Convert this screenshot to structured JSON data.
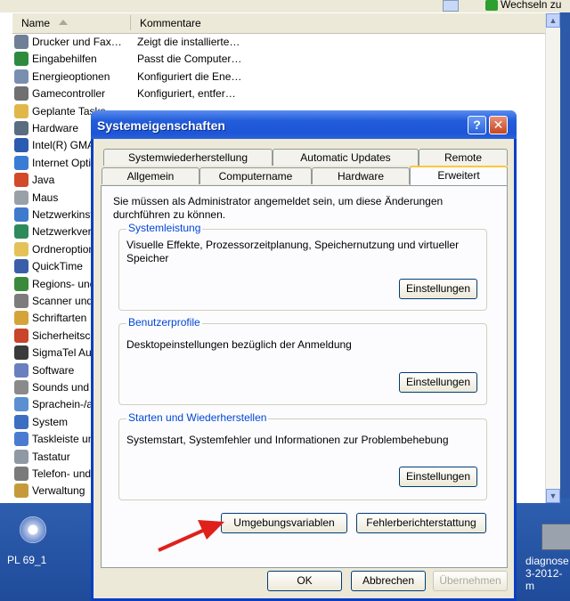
{
  "topbar": {
    "go_label": "Wechseln zu"
  },
  "explorer": {
    "columns": {
      "name": "Name",
      "comment": "Kommentare"
    },
    "rows": [
      {
        "name": "Drucker und Fax…",
        "comment": "Zeigt die installierte…",
        "color": "#6f7f96"
      },
      {
        "name": "Eingabehilfen",
        "comment": "Passt die Computer…",
        "color": "#2e8b3e"
      },
      {
        "name": "Energieoptionen",
        "comment": "Konfiguriert die Ene…",
        "color": "#7a8fb0"
      },
      {
        "name": "Gamecontroller",
        "comment": "Konfiguriert, entfer…",
        "color": "#707070"
      },
      {
        "name": "Geplante Tasks",
        "comment": "",
        "color": "#e0b84a"
      },
      {
        "name": "Hardware",
        "comment": "",
        "color": "#5a6d80"
      },
      {
        "name": "Intel(R) GMA",
        "comment": "",
        "color": "#2a5bb0"
      },
      {
        "name": "Internet Optionen",
        "comment": "",
        "color": "#3a7bd5"
      },
      {
        "name": "Java",
        "comment": "",
        "color": "#d24a2a"
      },
      {
        "name": "Maus",
        "comment": "",
        "color": "#9aa0a8"
      },
      {
        "name": "Netzwerkinstallation",
        "comment": "",
        "color": "#3f7acc"
      },
      {
        "name": "Netzwerkverbindungen",
        "comment": "",
        "color": "#2f8a5a"
      },
      {
        "name": "Ordneroptionen",
        "comment": "",
        "color": "#e5c15a"
      },
      {
        "name": "QuickTime",
        "comment": "",
        "color": "#3a5fa8"
      },
      {
        "name": "Regions- und Sprachoptionen",
        "comment": "",
        "color": "#3b8a3b"
      },
      {
        "name": "Scanner und Kameras",
        "comment": "",
        "color": "#7c7c7c"
      },
      {
        "name": "Schriftarten",
        "comment": "",
        "color": "#d4a43a"
      },
      {
        "name": "Sicherheitscenter",
        "comment": "",
        "color": "#c8442a"
      },
      {
        "name": "SigmaTel Audio",
        "comment": "",
        "color": "#3a3a3a"
      },
      {
        "name": "Software",
        "comment": "",
        "color": "#6a7fbf"
      },
      {
        "name": "Sounds und Audiogeräte",
        "comment": "",
        "color": "#8a8a8a"
      },
      {
        "name": "Sprachein-/ausgabe",
        "comment": "",
        "color": "#5b8fd1"
      },
      {
        "name": "System",
        "comment": "",
        "color": "#3c6ec2"
      },
      {
        "name": "Taskleiste und Startmenü",
        "comment": "",
        "color": "#4a7bd1"
      },
      {
        "name": "Tastatur",
        "comment": "",
        "color": "#9098a4"
      },
      {
        "name": "Telefon- und Modemoptionen",
        "comment": "",
        "color": "#7a7a7a"
      },
      {
        "name": "Verwaltung",
        "comment": "",
        "color": "#c69a3a"
      }
    ]
  },
  "desktop": {
    "icon1_label": "PL 69_1",
    "icon2_label1": "diagnose",
    "icon2_label2": "3-2012-m"
  },
  "dialog": {
    "title": "Systemeigenschaften",
    "help_symbol": "?",
    "close_symbol": "✕",
    "tabs_back": [
      "Systemwiederherstellung",
      "Automatic Updates",
      "Remote"
    ],
    "tabs_front": [
      "Allgemein",
      "Computername",
      "Hardware",
      "Erweitert"
    ],
    "active_tab": "Erweitert",
    "admin_text": "Sie müssen als Administrator angemeldet sein, um diese Änderungen durchführen zu können.",
    "groups": [
      {
        "label": "Systemleistung",
        "text": "Visuelle Effekte, Prozessorzeitplanung, Speichernutzung und virtueller Speicher",
        "button": "Einstellungen"
      },
      {
        "label": "Benutzerprofile",
        "text": "Desktopeinstellungen bezüglich der Anmeldung",
        "button": "Einstellungen"
      },
      {
        "label": "Starten und Wiederherstellen",
        "text": "Systemstart, Systemfehler und Informationen zur Problembehebung",
        "button": "Einstellungen"
      }
    ],
    "env_button": "Umgebungsvariablen",
    "error_button": "Fehlerberichterstattung",
    "ok": "OK",
    "cancel": "Abbrechen",
    "apply": "Übernehmen"
  },
  "colors": {
    "title_blue": "#245edb",
    "group_label": "#0046d5",
    "annotation_arrow": "#e0201a"
  }
}
